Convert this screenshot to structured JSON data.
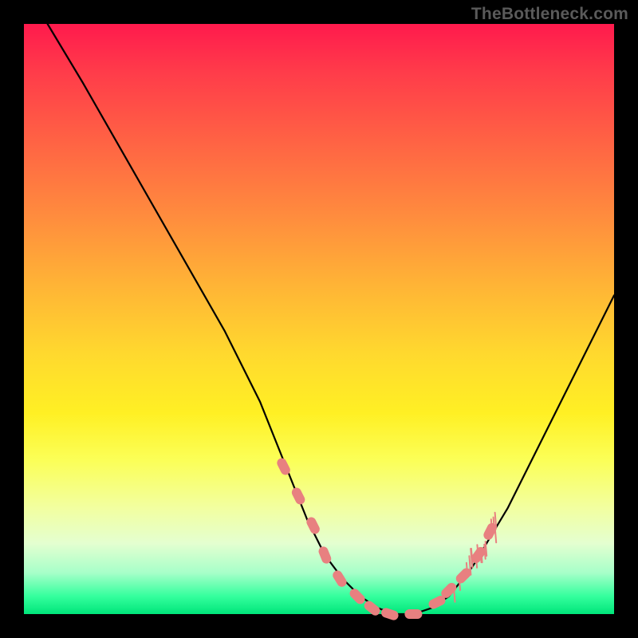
{
  "watermark": "TheBottleneck.com",
  "chart_data": {
    "type": "line",
    "title": "",
    "xlabel": "",
    "ylabel": "",
    "xlim": [
      0,
      100
    ],
    "ylim": [
      0,
      100
    ],
    "grid": false,
    "legend": false,
    "series": [
      {
        "name": "bottleneck-curve",
        "color": "#000000",
        "x": [
          4,
          10,
          18,
          26,
          34,
          40,
          44,
          48,
          51,
          54,
          57,
          60,
          63,
          66,
          69,
          72,
          76,
          82,
          88,
          94,
          100
        ],
        "values": [
          100,
          90,
          76,
          62,
          48,
          36,
          26,
          16,
          10,
          6,
          3,
          1,
          0,
          0,
          1,
          3,
          8,
          18,
          30,
          42,
          54
        ]
      }
    ],
    "markers": {
      "name": "highlight-points",
      "shape": "capsule",
      "color": "#e88080",
      "x": [
        44,
        46.5,
        49,
        51,
        53.5,
        56.5,
        59,
        62,
        66,
        70,
        72,
        74.5,
        77,
        79
      ],
      "values": [
        25,
        20,
        15,
        10,
        6,
        3,
        1,
        0,
        0,
        2,
        4,
        6.5,
        10,
        14
      ]
    },
    "hatch": {
      "name": "sparse-ticks",
      "color": "#e88080",
      "x_range": [
        72,
        80
      ],
      "y_range": [
        3,
        15
      ]
    },
    "background_gradient": {
      "top": "#ff1a4d",
      "mid": "#ffe030",
      "bottom": "#00e57a"
    }
  }
}
